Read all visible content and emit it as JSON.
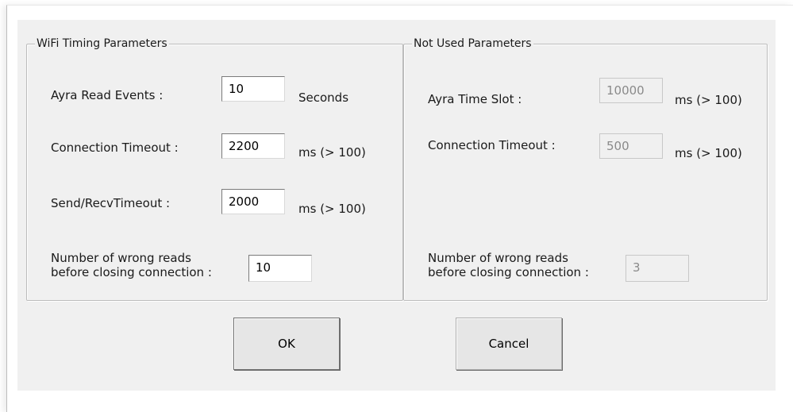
{
  "wifi_group": {
    "title": "WiFi Timing Parameters",
    "read_events": {
      "label": "Ayra Read Events :",
      "value": "10",
      "unit": "Seconds"
    },
    "connection_timeout": {
      "label": "Connection Timeout :",
      "value": "2200",
      "unit": "ms (> 100)"
    },
    "send_recv_timeout": {
      "label": "Send/RecvTimeout :",
      "value": "2000",
      "unit": "ms (> 100)"
    },
    "wrong_reads": {
      "label_line1": "Number of wrong reads",
      "label_line2": "before closing connection :",
      "value": "10"
    }
  },
  "unused_group": {
    "title": "Not Used Parameters",
    "time_slot": {
      "label": "Ayra Time Slot :",
      "value": "10000",
      "unit": "ms (> 100)"
    },
    "connection_timeout": {
      "label": "Connection Timeout :",
      "value": "500",
      "unit": "ms (> 100)"
    },
    "wrong_reads": {
      "label_line1": "Number of wrong reads",
      "label_line2": "before closing connection :",
      "value": "3"
    }
  },
  "buttons": {
    "ok": "OK",
    "cancel": "Cancel"
  }
}
